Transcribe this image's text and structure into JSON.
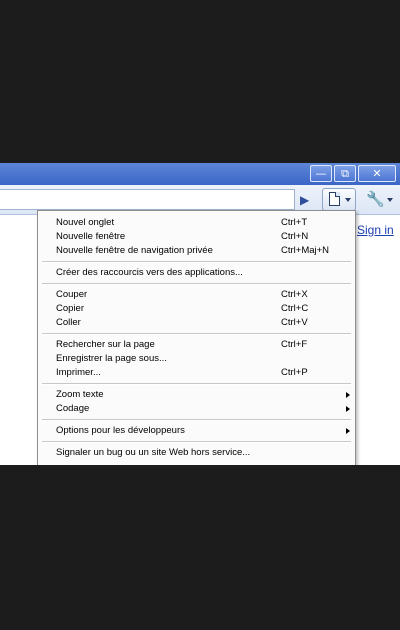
{
  "window": {
    "minimize_glyph": "—",
    "maximize_glyph": "⧉",
    "close_glyph": "✕"
  },
  "toolbar": {
    "go_glyph": "▶",
    "page_menu_icon": "page-icon",
    "wrench_glyph": "🔧"
  },
  "page": {
    "signin_label": "Sign in"
  },
  "menu": {
    "items": [
      {
        "label": "Nouvel onglet",
        "shortcut": "Ctrl+T"
      },
      {
        "label": "Nouvelle fenêtre",
        "shortcut": "Ctrl+N"
      },
      {
        "label": "Nouvelle fenêtre de navigation privée",
        "shortcut": "Ctrl+Maj+N"
      },
      {
        "label": "Créer des raccourcis vers des applications..."
      },
      {
        "label": "Couper",
        "shortcut": "Ctrl+X"
      },
      {
        "label": "Copier",
        "shortcut": "Ctrl+C"
      },
      {
        "label": "Coller",
        "shortcut": "Ctrl+V"
      },
      {
        "label": "Rechercher sur la page",
        "shortcut": "Ctrl+F"
      },
      {
        "label": "Enregistrer la page sous..."
      },
      {
        "label": "Imprimer...",
        "shortcut": "Ctrl+P"
      },
      {
        "label": "Zoom texte"
      },
      {
        "label": "Codage"
      },
      {
        "label": "Options pour les développeurs"
      },
      {
        "label": "Signaler un bug ou un site Web hors service..."
      }
    ]
  },
  "colors": {
    "titlebar": "#3b66c6",
    "link": "#1a3fb0",
    "background": "#1c1c1c"
  }
}
